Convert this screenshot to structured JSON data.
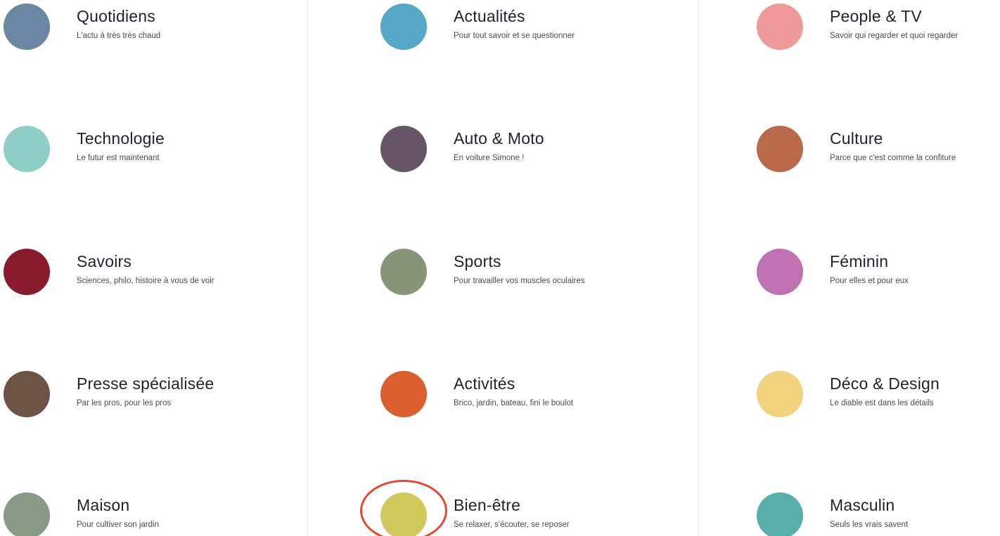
{
  "columns": [
    {
      "items": [
        {
          "id": "quotidiens",
          "title": "Quotidiens",
          "subtitle": "L'actu à très très chaud",
          "color": "#6a86a2"
        },
        {
          "id": "technologie",
          "title": "Technologie",
          "subtitle": "Le futur est maintenant",
          "color": "#8ecec6"
        },
        {
          "id": "savoirs",
          "title": "Savoirs",
          "subtitle": "Sciences, philo, histoire à vous de voir",
          "color": "#8a1a2d"
        },
        {
          "id": "presse-specialisee",
          "title": "Presse spécialisée",
          "subtitle": "Par les pros, pour les pros",
          "color": "#6e5446"
        },
        {
          "id": "maison",
          "title": "Maison",
          "subtitle": "Pour cultiver son jardin",
          "color": "#869a86"
        }
      ]
    },
    {
      "items": [
        {
          "id": "actualites",
          "title": "Actualités",
          "subtitle": "Pour tout savoir et se questionner",
          "color": "#56a8c8"
        },
        {
          "id": "auto-moto",
          "title": "Auto & Moto",
          "subtitle": "En voiture Simone !",
          "color": "#665668"
        },
        {
          "id": "sports",
          "title": "Sports",
          "subtitle": "Pour travailler vos muscles oculaires",
          "color": "#879678"
        },
        {
          "id": "activites",
          "title": "Activités",
          "subtitle": "Brico, jardin, bateau, fini le boulot",
          "color": "#da5e2e"
        },
        {
          "id": "bien-etre",
          "title": "Bien-être",
          "subtitle": "Se relaxer, s'écouter, se reposer",
          "color": "#cfc85a"
        }
      ]
    },
    {
      "items": [
        {
          "id": "people-tv",
          "title": "People & TV",
          "subtitle": "Savoir qui regarder et quoi regarder",
          "color": "#ee9a9a"
        },
        {
          "id": "culture",
          "title": "Culture",
          "subtitle": "Parce que c'est comme la confiture",
          "color": "#b86a4a"
        },
        {
          "id": "feminin",
          "title": "Féminin",
          "subtitle": "Pour elles et pour eux",
          "color": "#be72b2"
        },
        {
          "id": "deco-design",
          "title": "Déco & Design",
          "subtitle": "Le diable est dans les détails",
          "color": "#f2d27e"
        },
        {
          "id": "masculin",
          "title": "Masculin",
          "subtitle": "Seuls les vrais savent",
          "color": "#58aea8"
        }
      ]
    }
  ],
  "highlight": {
    "color": "#de4a32",
    "target": "bien-etre"
  }
}
